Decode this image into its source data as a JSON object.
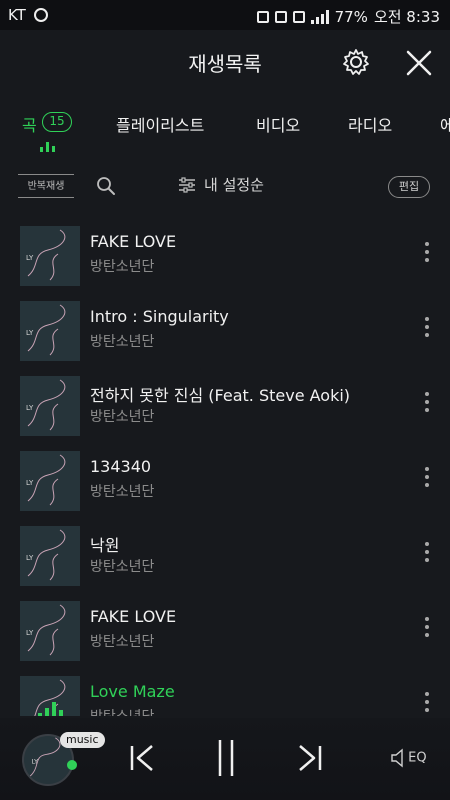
{
  "status": {
    "carrier": "KT",
    "battery": "77%",
    "time": "오전 8:33"
  },
  "header": {
    "title": "재생목록"
  },
  "tabs": [
    {
      "label": "곡",
      "count": "15",
      "active": true
    },
    {
      "label": "플레이리스트"
    },
    {
      "label": "비디오"
    },
    {
      "label": "라디오"
    },
    {
      "label": "에"
    }
  ],
  "toolbar": {
    "repeat_label": "반복재생",
    "sort_label": "내 설정순",
    "edit_label": "편집"
  },
  "songs": [
    {
      "title": "FAKE LOVE",
      "artist": "방탄소년단"
    },
    {
      "title": "Intro : Singularity",
      "artist": "방탄소년단"
    },
    {
      "title": "전하지 못한 진심 (Feat. Steve Aoki)",
      "artist": "방탄소년단"
    },
    {
      "title": "134340",
      "artist": "방탄소년단"
    },
    {
      "title": "낙원",
      "artist": "방탄소년단"
    },
    {
      "title": "FAKE LOVE",
      "artist": "방탄소년단"
    },
    {
      "title": "Love Maze",
      "artist": "방탄소년단",
      "playing": true
    }
  ],
  "player": {
    "badge": "music",
    "eq_label": "EQ"
  },
  "colors": {
    "accent": "#30d158",
    "background": "#17191d"
  }
}
